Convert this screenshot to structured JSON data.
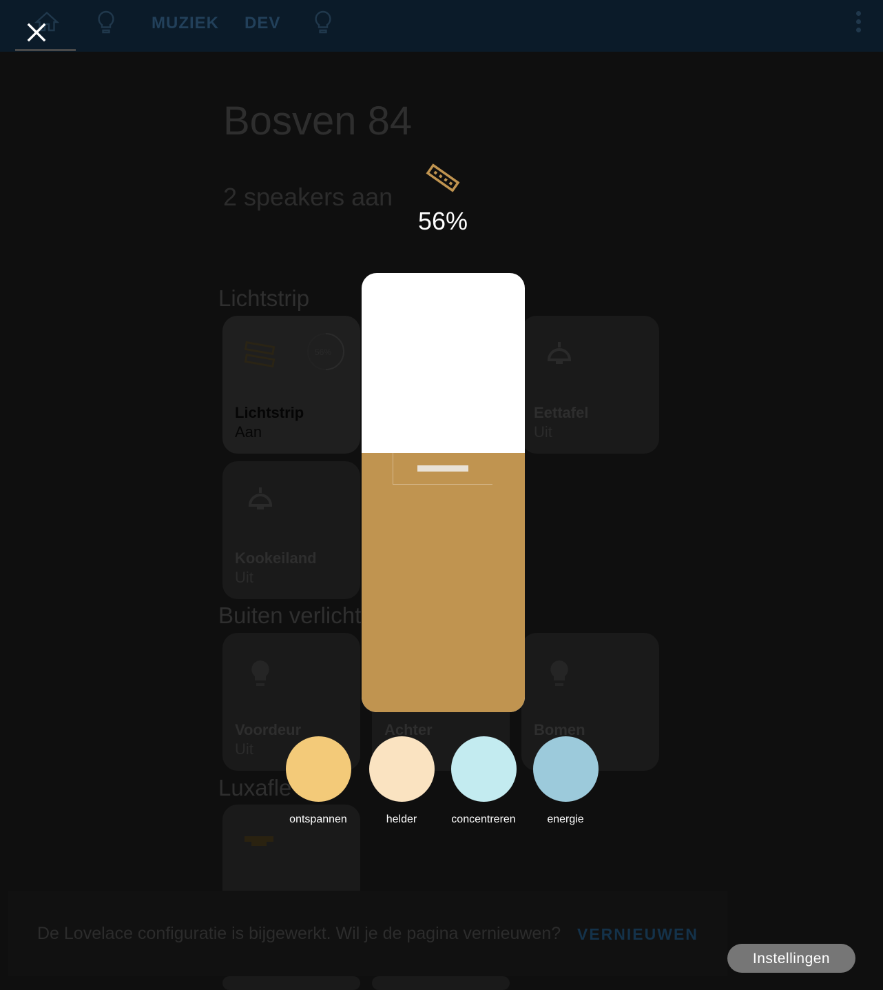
{
  "topbar": {
    "tabs": [
      {
        "icon": "home-icon"
      },
      {
        "icon": "lightbulb-icon"
      },
      {
        "label": "MUZIEK"
      },
      {
        "label": "DEV"
      },
      {
        "icon": "lightbulb-outline-icon"
      }
    ],
    "menu_icon": "dots-vertical-icon"
  },
  "dashboard": {
    "title": "Bosven 84",
    "subtitle": "2 speakers aan",
    "sections": [
      {
        "title": "Lichtstrip"
      },
      {
        "title": "Buiten verlicht"
      },
      {
        "title": "Luxafle"
      }
    ],
    "tiles": [
      {
        "name": "Lichtstrip",
        "state": "Aan",
        "icon": "led-strip-icon",
        "brightness_label": "56%"
      },
      {
        "name": "Eettafel",
        "state": "Uit",
        "icon": "ceiling-light-icon"
      },
      {
        "name": "Kookeiland",
        "state": "Uit",
        "icon": "ceiling-light-icon"
      },
      {
        "name": "Voordeur",
        "state": "Uit",
        "icon": "lightbulb-icon"
      },
      {
        "name": "Achter",
        "state": "",
        "icon": "lightbulb-icon"
      },
      {
        "name": "Bomen",
        "state": "",
        "icon": "lightbulb-icon"
      },
      {
        "name": "",
        "state": "",
        "icon": "blinds-icon"
      }
    ]
  },
  "toast": {
    "message": "De Lovelace configuratie is bijgewerkt. Wil je de pagina vernieuwen?",
    "action": "VERNIEUWEN"
  },
  "dialog": {
    "close_icon": "close-icon",
    "entity_icon": "led-strip-icon",
    "brightness_label": "56%",
    "brightness": 0.56,
    "colors": {
      "accent": "#c09450",
      "slider_bg": "#ffffff"
    },
    "presets": [
      {
        "label": "ontspannen",
        "color": "#f3ca79"
      },
      {
        "label": "helder",
        "color": "#fae3c1"
      },
      {
        "label": "concentreren",
        "color": "#c3ebf0"
      },
      {
        "label": "energie",
        "color": "#9ccadb"
      }
    ],
    "settings_label": "Instellingen"
  }
}
